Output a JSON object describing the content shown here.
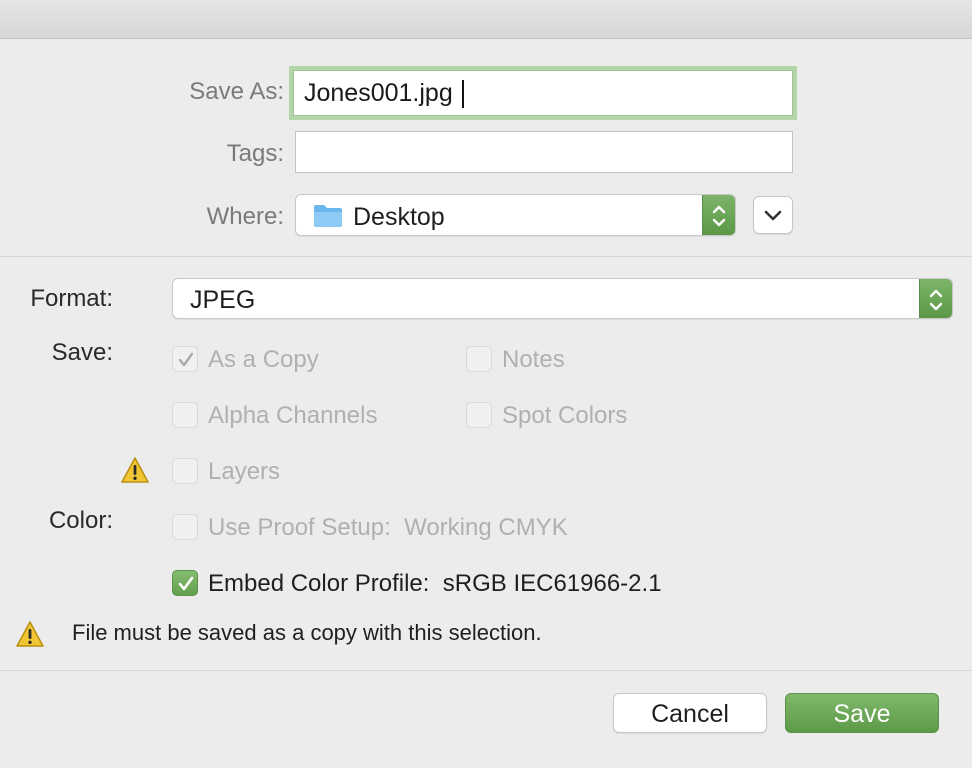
{
  "file": {
    "save_as_label": "Save As:",
    "save_as_value": "Jones001.jpg",
    "tags_label": "Tags:",
    "tags_value": "",
    "where_label": "Where:",
    "where_value": "Desktop",
    "where_icon": "folder-icon"
  },
  "options": {
    "format_label": "Format:",
    "format_value": "JPEG",
    "save_label": "Save:",
    "save_checks": [
      {
        "label": "As a Copy",
        "checked": true,
        "enabled": false
      },
      {
        "label": "Notes",
        "checked": false,
        "enabled": false
      },
      {
        "label": "Alpha Channels",
        "checked": false,
        "enabled": false
      },
      {
        "label": "Spot Colors",
        "checked": false,
        "enabled": false
      },
      {
        "label": "Layers",
        "checked": false,
        "enabled": false
      }
    ],
    "color_label": "Color:",
    "color_checks": [
      {
        "label": "Use Proof Setup:  Working CMYK",
        "checked": false,
        "enabled": false
      },
      {
        "label": "Embed Color Profile:  sRGB IEC61966-2.1",
        "checked": true,
        "enabled": true
      }
    ],
    "warning_message": "File must be saved as a copy with this selection."
  },
  "buttons": {
    "cancel": "Cancel",
    "save": "Save"
  },
  "colors": {
    "accent_green": "#6aa856",
    "focus_ring": "#b5d4aa",
    "warning_yellow": "#f2c633"
  }
}
